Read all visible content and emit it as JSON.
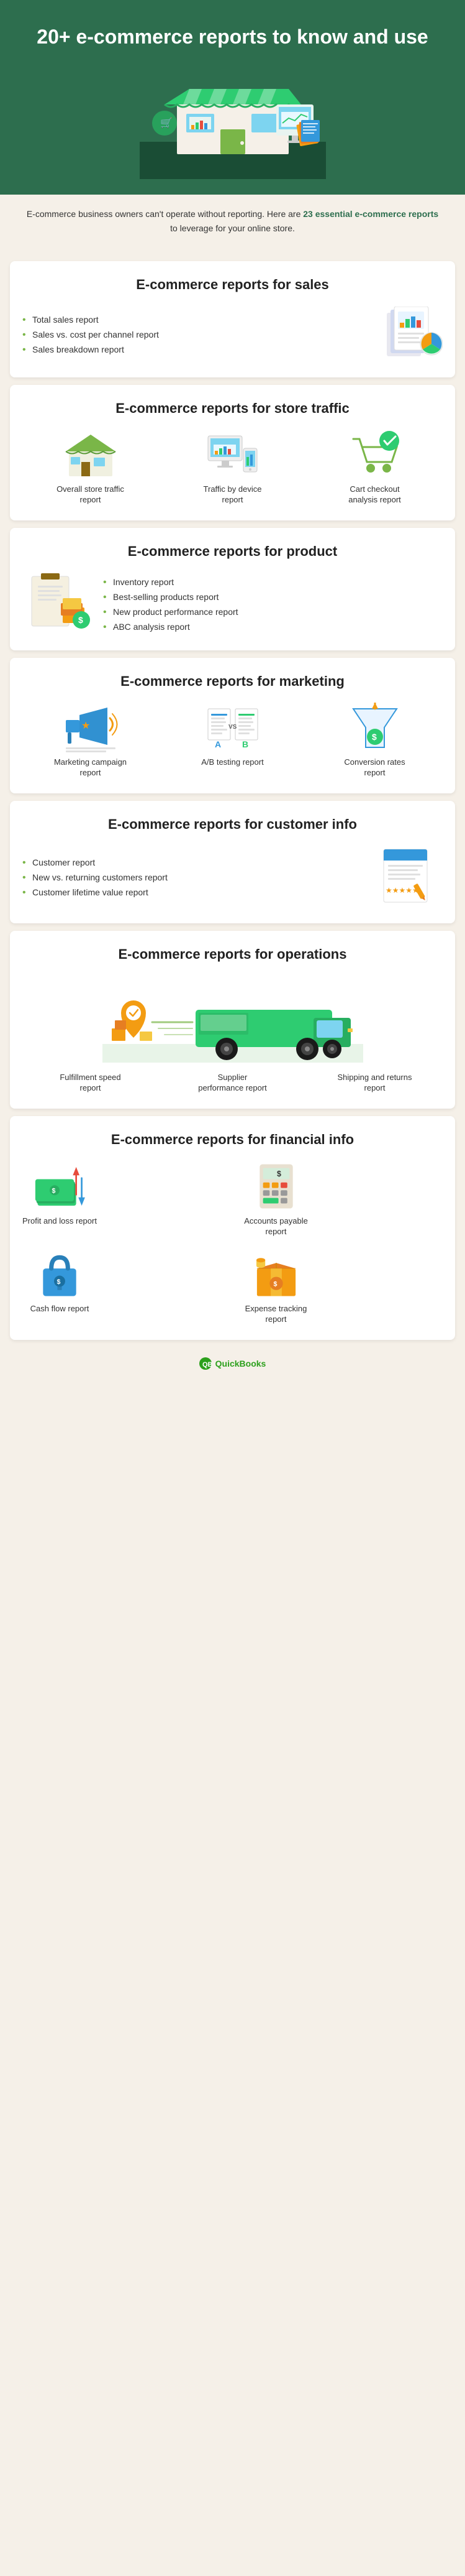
{
  "hero": {
    "title": "20+ e-commerce reports to know and use",
    "description": "E-commerce business owners can't operate without reporting. Here are",
    "highlight": "23 essential e-commerce reports",
    "description_end": "to leverage for your online store."
  },
  "sections": {
    "sales": {
      "title": "E-commerce reports for sales",
      "items": [
        "Total sales report",
        "Sales vs. cost per channel report",
        "Sales breakdown report"
      ]
    },
    "traffic": {
      "title": "E-commerce reports for store traffic",
      "items": [
        {
          "label": "Overall store traffic report"
        },
        {
          "label": "Traffic by device report"
        },
        {
          "label": "Cart checkout analysis report"
        }
      ]
    },
    "product": {
      "title": "E-commerce reports for product",
      "items": [
        "Inventory report",
        "Best-selling products report",
        "New product performance report",
        "ABC analysis report"
      ]
    },
    "marketing": {
      "title": "E-commerce reports for marketing",
      "items": [
        {
          "label": "Marketing campaign report"
        },
        {
          "label": "A/B testing report"
        },
        {
          "label": "Conversion rates report"
        }
      ]
    },
    "customer": {
      "title": "E-commerce reports for customer info",
      "items": [
        "Customer report",
        "New vs. returning customers report",
        "Customer lifetime value report"
      ]
    },
    "operations": {
      "title": "E-commerce reports for operations",
      "items": [
        {
          "label": "Fulfillment speed report"
        },
        {
          "label": "Supplier performance report"
        },
        {
          "label": "Shipping and returns report"
        }
      ]
    },
    "financial": {
      "title": "E-commerce reports for financial info",
      "items": [
        {
          "label": "Profit and loss report"
        },
        {
          "label": "Accounts payable report"
        },
        {
          "label": "Cash flow report"
        },
        {
          "label": "Expense tracking report"
        }
      ]
    }
  },
  "footer": {
    "brand": "quickbooks",
    "logo_text": "QuickBooks"
  }
}
